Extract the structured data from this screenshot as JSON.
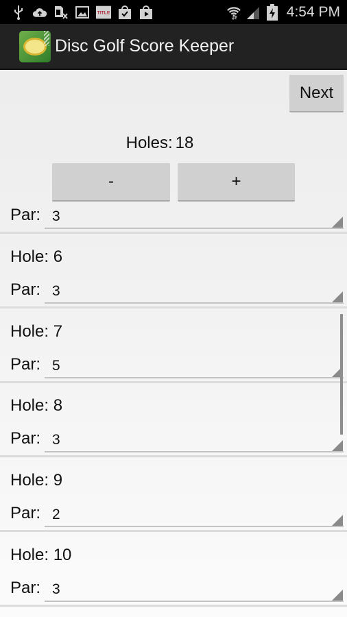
{
  "status_bar": {
    "left_icons": [
      "usb-icon",
      "cloud-upload-icon",
      "sim-card-error-icon",
      "image-icon",
      "title-app-icon",
      "shopping-bag-check-icon",
      "play-store-icon"
    ],
    "right_icons": [
      "wifi-icon",
      "signal-icon",
      "battery-charging-icon"
    ],
    "time": "4:54 PM"
  },
  "action_bar": {
    "app_icon": "disc-golf-app-icon",
    "title": "Disc Golf Score Keeper"
  },
  "toolbar": {
    "next_label": "Next",
    "minus_label": "-",
    "plus_label": "+"
  },
  "holes": {
    "label": "Holes:",
    "value": "18"
  },
  "partial_item": {
    "par_label": "Par:",
    "par_value": "3"
  },
  "hole_items": [
    {
      "hole_label": "Hole: 6",
      "par_label": "Par:",
      "par_value": "3"
    },
    {
      "hole_label": "Hole: 7",
      "par_label": "Par:",
      "par_value": "5"
    },
    {
      "hole_label": "Hole: 8",
      "par_label": "Par:",
      "par_value": "3"
    },
    {
      "hole_label": "Hole: 9",
      "par_label": "Par:",
      "par_value": "2"
    },
    {
      "hole_label": "Hole: 10",
      "par_label": "Par:",
      "par_value": "3"
    }
  ]
}
